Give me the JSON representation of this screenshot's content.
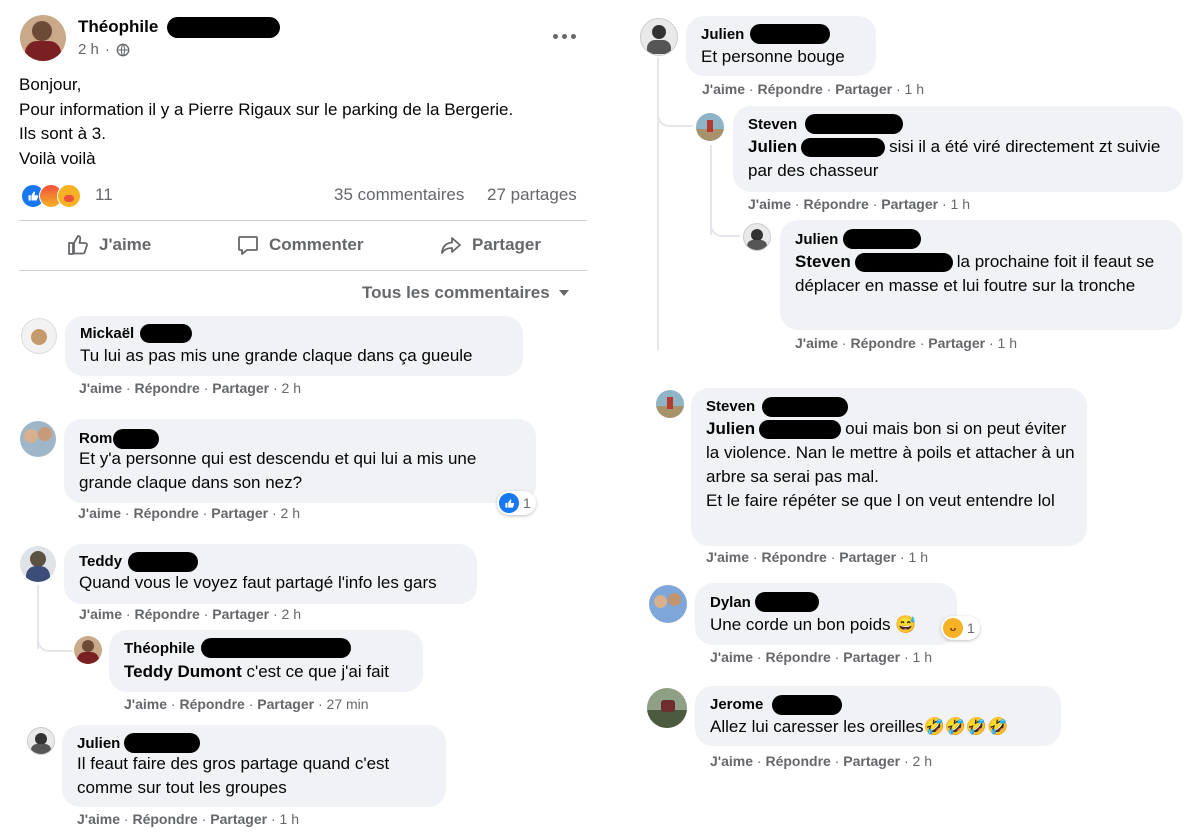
{
  "post": {
    "author": "Théophile",
    "time": "2 h",
    "lines": [
      "Bonjour,",
      "Pour information il y a Pierre Rigaux sur le parking de la Bergerie.",
      "Ils sont à 3.",
      "Voilà voilà"
    ],
    "reaction_count": "11",
    "comments_count": "35 commentaires",
    "shares_count": "27 partages"
  },
  "actions": {
    "like": "J'aime",
    "comment": "Commenter",
    "share": "Partager"
  },
  "sort": {
    "label": "Tous les commentaires"
  },
  "meta": {
    "like": "J'aime",
    "reply": "Répondre",
    "share": "Partager"
  },
  "comments": [
    {
      "name": "Mickaël",
      "text": "Tu lui as pas mis une grande claque dans ça gueule",
      "time": "2 h"
    },
    {
      "name": "Rom",
      "text": "Et y'a personne qui est descendu et qui lui a mis une grande claque dans son nez?",
      "time": "2 h",
      "reactions": "1"
    },
    {
      "name": "Teddy",
      "text": "Quand vous le voyez faut partagé l'info les gars",
      "time": "2 h"
    },
    {
      "name": "Théophile",
      "mention": "Teddy Dumont",
      "text": " c'est ce que j'ai fait",
      "time": "27 min"
    },
    {
      "name": "Julien",
      "text": "Il feaut faire des gros partage quand c'est comme sur tout les groupes",
      "time": "1 h"
    },
    {
      "name": "Julien",
      "text": "Et personne bouge",
      "time": "1 h"
    },
    {
      "name": "Steven",
      "mention": "Julien",
      "text": "sisi il a été viré directement zt suivie par des chasseur",
      "time": "1 h"
    },
    {
      "name": "Julien",
      "mention": "Steven",
      "text": "la prochaine foit il feaut se déplacer en masse et lui foutre sur la tronche",
      "time": "1 h"
    },
    {
      "name": "Steven",
      "mention": "Julien",
      "text": "oui mais bon si on peut éviter la violence. Nan le mettre à poils et attacher à un arbre sa serai pas mal.",
      "text2": "Et le faire répéter se que l on veut entendre lol",
      "time": "1 h"
    },
    {
      "name": "Dylan",
      "text": "Une corde un bon poids 😅",
      "time": "1 h",
      "reactions": "1"
    },
    {
      "name": "Jerome",
      "text": "Allez lui caresser les oreilles🤣🤣🤣🤣",
      "time": "2 h"
    }
  ],
  "colors": {
    "like_blue": "#1877f2",
    "angry": "#f0513a",
    "care": "#f7b125",
    "meta_gray": "#65676b",
    "bubble": "#f0f2f5"
  }
}
